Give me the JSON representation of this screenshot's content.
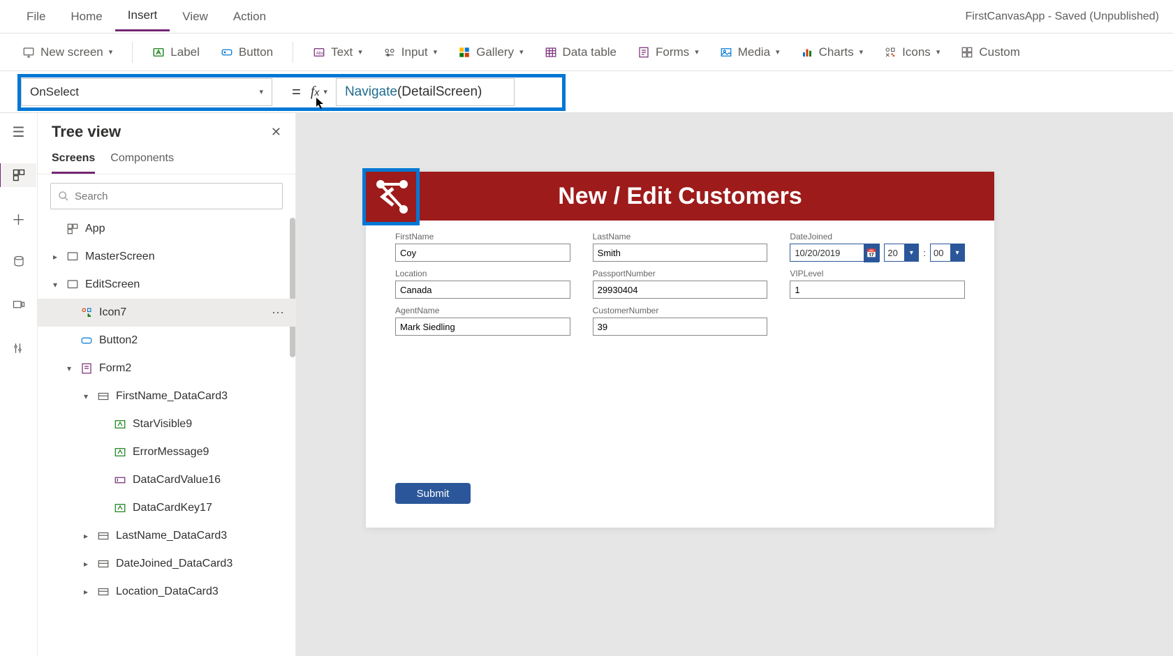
{
  "menu": {
    "file": "File",
    "home": "Home",
    "insert": "Insert",
    "view": "View",
    "action": "Action"
  },
  "app_title": "FirstCanvasApp - Saved (Unpublished)",
  "ribbon": {
    "new_screen": "New screen",
    "label": "Label",
    "button": "Button",
    "text": "Text",
    "input": "Input",
    "gallery": "Gallery",
    "data_table": "Data table",
    "forms": "Forms",
    "media": "Media",
    "charts": "Charts",
    "icons": "Icons",
    "custom": "Custom"
  },
  "formula": {
    "property": "OnSelect",
    "expression_fn": "Navigate",
    "expression_arg": "(DetailScreen)"
  },
  "sidepanel": {
    "title": "Tree view",
    "tab_screens": "Screens",
    "tab_components": "Components",
    "search_placeholder": "Search"
  },
  "tree": {
    "app": "App",
    "master": "MasterScreen",
    "edit": "EditScreen",
    "icon7": "Icon7",
    "button2": "Button2",
    "form2": "Form2",
    "fn_card": "FirstName_DataCard3",
    "star": "StarVisible9",
    "err": "ErrorMessage9",
    "dcv": "DataCardValue16",
    "dck": "DataCardKey17",
    "ln_card": "LastName_DataCard3",
    "dj_card": "DateJoined_DataCard3",
    "loc_card": "Location_DataCard3"
  },
  "canvas": {
    "header": "New / Edit Customers",
    "labels": {
      "first": "FirstName",
      "last": "LastName",
      "date": "DateJoined",
      "loc": "Location",
      "passport": "PassportNumber",
      "vip": "VIPLevel",
      "agent": "AgentName",
      "cust": "CustomerNumber"
    },
    "values": {
      "first": "Coy",
      "last": "Smith",
      "date": "10/20/2019",
      "hh": "20",
      "mm": "00",
      "loc": "Canada",
      "passport": "29930404",
      "vip": "1",
      "agent": "Mark Siedling",
      "cust": "39"
    },
    "submit": "Submit"
  }
}
